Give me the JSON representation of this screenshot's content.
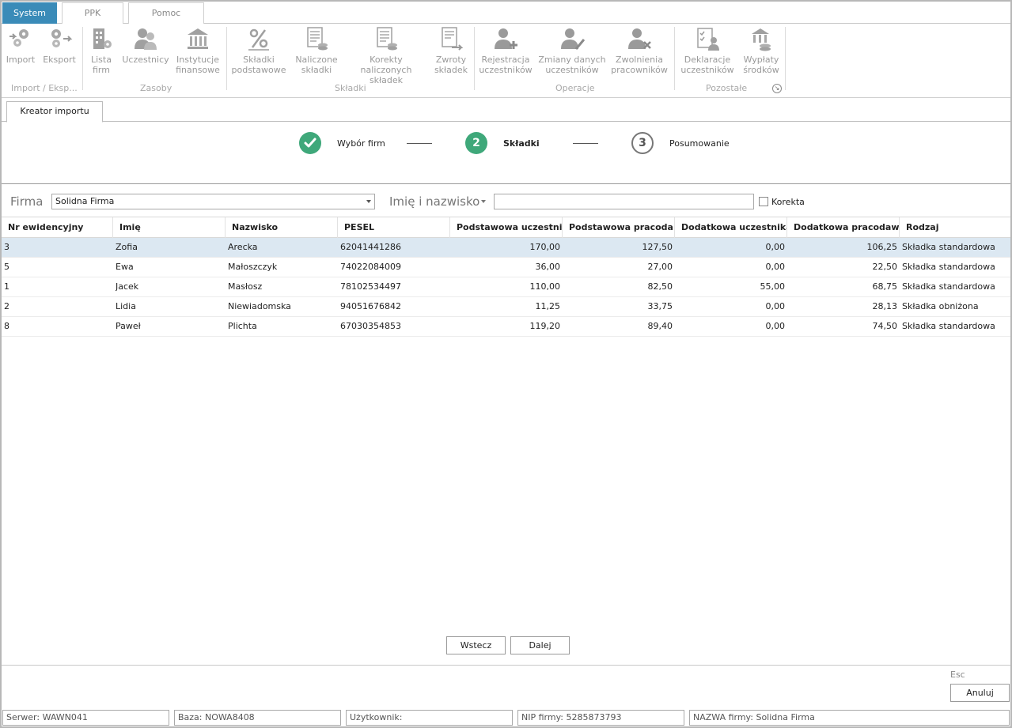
{
  "ribbon_tabs": [
    "System",
    "PPK",
    "Pomoc"
  ],
  "ribbon": {
    "buttons": [
      {
        "label1": "Import",
        "label2": ""
      },
      {
        "label1": "Eksport",
        "label2": ""
      },
      {
        "label1": "Lista",
        "label2": "firm"
      },
      {
        "label1": "Uczestnicy",
        "label2": ""
      },
      {
        "label1": "Instytucje",
        "label2": "finansowe"
      },
      {
        "label1": "Składki",
        "label2": "podstawowe"
      },
      {
        "label1": "Naliczone",
        "label2": "składki"
      },
      {
        "label1": "Korekty naliczonych",
        "label2": "składek"
      },
      {
        "label1": "Zwroty",
        "label2": "składek"
      },
      {
        "label1": "Rejestracja",
        "label2": "uczestników"
      },
      {
        "label1": "Zmiany danych",
        "label2": "uczestników"
      },
      {
        "label1": "Zwolnienia",
        "label2": "pracowników"
      },
      {
        "label1": "Deklaracje",
        "label2": "uczestników"
      },
      {
        "label1": "Wypłaty",
        "label2": "środków"
      }
    ],
    "groups": [
      "Import / Eksp...",
      "Zasoby",
      "Składki",
      "Operacje",
      "Pozostałe"
    ]
  },
  "doc_tab": "Kreator importu",
  "wizard": {
    "steps": [
      {
        "number": "",
        "label": "Wybór firm",
        "state": "done"
      },
      {
        "number": "2",
        "label": "Składki",
        "state": "active"
      },
      {
        "number": "3",
        "label": "Posumowanie",
        "state": "todo"
      }
    ]
  },
  "filter": {
    "firma_label": "Firma",
    "firma_value": "Solidna Firma",
    "name_label": "Imię i nazwisko",
    "name_value": "",
    "korekta_label": "Korekta"
  },
  "table": {
    "columns": [
      "Nr ewidencyjny",
      "Imię",
      "Nazwisko",
      "PESEL",
      "Podstawowa uczestnika",
      "Podstawowa pracoda...",
      "Dodatkowa uczestnika",
      "Dodatkowa pracodawcy",
      "Rodzaj"
    ],
    "rows": [
      [
        "3",
        "Zofia",
        "Arecka",
        "62041441286",
        "170,00",
        "127,50",
        "0,00",
        "106,25",
        "Składka standardowa"
      ],
      [
        "5",
        "Ewa",
        "Małoszczyk",
        "74022084009",
        "36,00",
        "27,00",
        "0,00",
        "22,50",
        "Składka standardowa"
      ],
      [
        "1",
        "Jacek",
        "Masłosz",
        "78102534497",
        "110,00",
        "82,50",
        "55,00",
        "68,75",
        "Składka standardowa"
      ],
      [
        "2",
        "Lidia",
        "Niewiadomska",
        "94051676842",
        "11,25",
        "33,75",
        "0,00",
        "28,13",
        "Składka obniżona"
      ],
      [
        "8",
        "Paweł",
        "Plichta",
        "67030354853",
        "119,20",
        "89,40",
        "0,00",
        "74,50",
        "Składka standardowa"
      ]
    ]
  },
  "buttons": {
    "back": "Wstecz",
    "next": "Dalej",
    "esc_hint": "Esc",
    "cancel": "Anuluj"
  },
  "status": {
    "server": "Serwer: WAWN041",
    "db": "Baza: NOWA8408",
    "user": "Użytkownik:",
    "nip": "NIP firmy: 5285873793",
    "company": "NAZWA firmy: Solidna Firma"
  },
  "colors": {
    "accent": "#3a8bb8",
    "step_green": "#3fa87a",
    "selected_row": "#dce8f2"
  }
}
